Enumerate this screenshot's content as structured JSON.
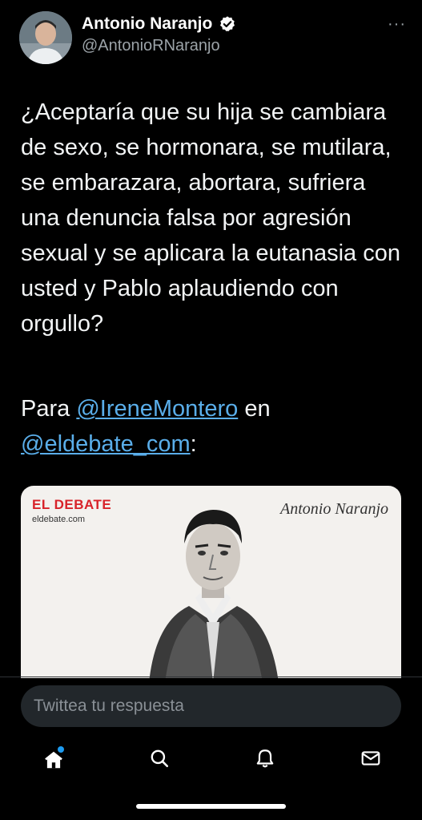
{
  "author": {
    "name": "Antonio Naranjo",
    "handle": "@AntonioRNaranjo",
    "verified": true
  },
  "menu": {
    "more_label": "···"
  },
  "tweet": {
    "text": "¿Aceptaría que su hija se cambiara de sexo, se hormonara, se mutilara, se embarazara, abortara, sufriera una denuncia falsa por agresión sexual y se aplicara la eutanasia con usted y Pablo aplaudiendo con orgullo?",
    "line2_prefix": "Para ",
    "mention1": "@IreneMontero",
    "line2_middle": " en",
    "mention2": "@eldebate_com",
    "line2_suffix": ":"
  },
  "card": {
    "logo": "EL DEBATE",
    "domain": "eldebate.com",
    "author": "Antonio Naranjo"
  },
  "reply": {
    "placeholder": "Twittea tu respuesta"
  },
  "nav": {
    "items": [
      {
        "icon": "home-icon",
        "active": true
      },
      {
        "icon": "search-icon"
      },
      {
        "icon": "bell-icon"
      },
      {
        "icon": "mail-icon"
      }
    ]
  },
  "colors": {
    "background": "#000000",
    "accent": "#1d9bf0",
    "mention": "#5aaeea",
    "card_logo": "#d8232a"
  }
}
